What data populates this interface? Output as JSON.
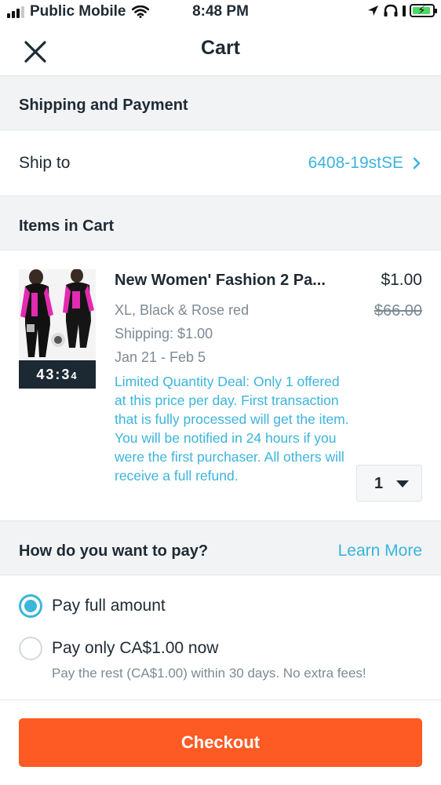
{
  "status_bar": {
    "carrier": "Public Mobile",
    "time": "8:48 PM",
    "icons": [
      "signal-icon",
      "wifi-icon",
      "location-arrow-icon",
      "headphones-icon",
      "battery-icon"
    ]
  },
  "header": {
    "title": "Cart",
    "close_icon": "close-icon"
  },
  "shipping_section": {
    "heading": "Shipping and Payment",
    "ship_to_label": "Ship to",
    "ship_to_value": "6408-19stSE"
  },
  "items_section": {
    "heading": "Items in Cart",
    "items": [
      {
        "title": "New Women' Fashion 2 Pa...",
        "price": "$1.00",
        "original_price": "$66.00",
        "variant": "XL, Black & Rose red",
        "shipping": "Shipping:  $1.00",
        "dates": "Jan 21 - Feb 5",
        "deal_text": "Limited Quantity Deal: Only 1 offered at this price per day. First transaction that is fully processed will get the item. You will be notified in 24 hours if you were the first purchaser. All others will receive a full refund.",
        "timer_main": "43:3",
        "timer_small": "4",
        "quantity": "1"
      }
    ]
  },
  "payment_section": {
    "heading": "How do you want to pay?",
    "learn_more": "Learn More",
    "options": [
      {
        "label": "Pay full amount",
        "selected": true
      },
      {
        "label": "Pay only CA$1.00 now",
        "selected": false
      }
    ],
    "partial_note": "Pay the rest (CA$1.00) within 30 days. No extra fees!"
  },
  "checkout_label": "Checkout",
  "colors": {
    "accent": "#3cb4dc",
    "checkout": "#fe5a24",
    "section_bg": "#f1f3f5",
    "text": "#1f2a33",
    "muted": "#7d8a94"
  }
}
